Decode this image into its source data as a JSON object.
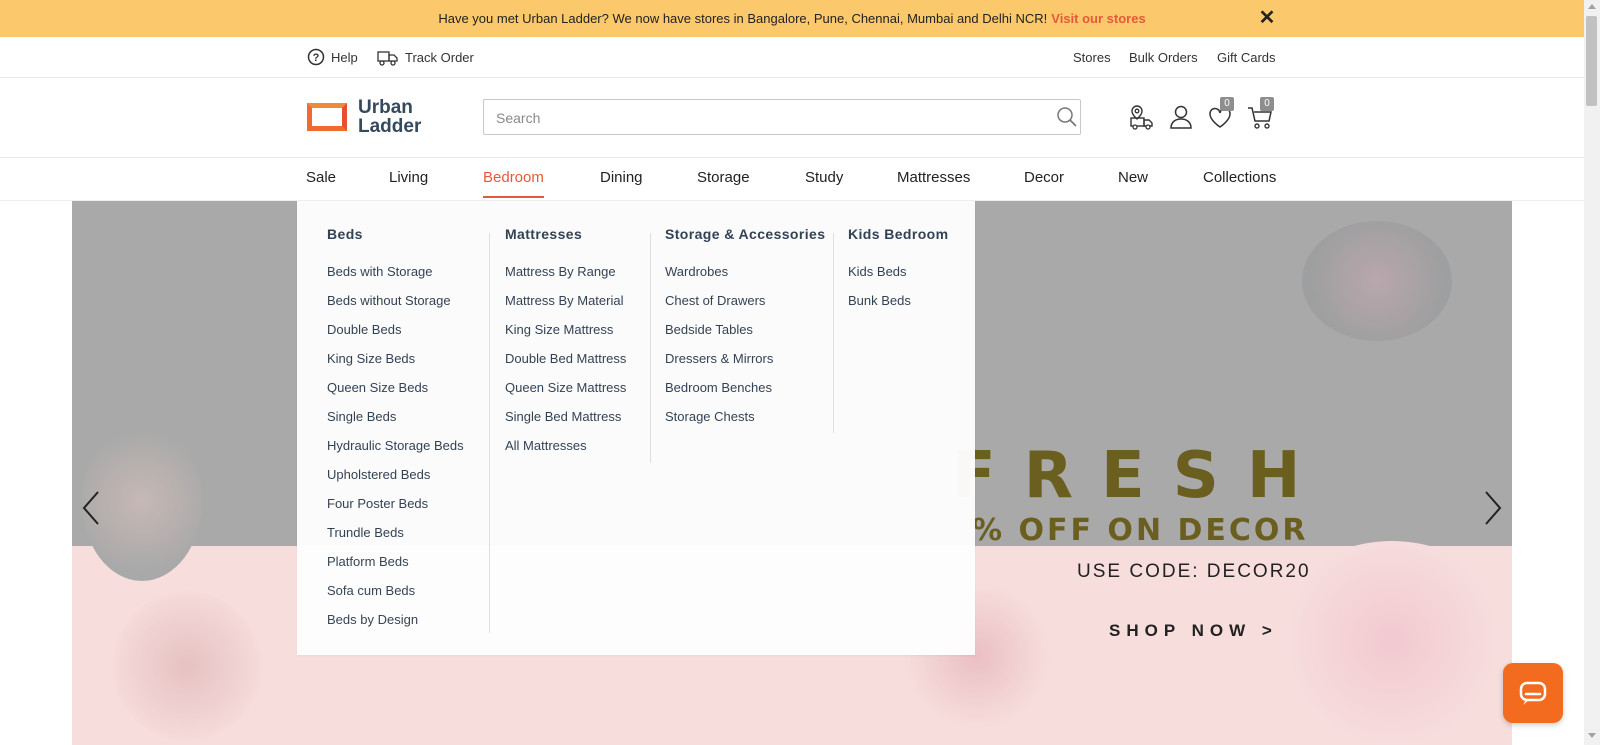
{
  "announcement": {
    "text": "Have you met Urban Ladder? We now have stores in Bangalore, Pune, Chennai, Mumbai and Delhi NCR!",
    "link": "Visit our stores"
  },
  "utility_bar": {
    "help": "Help",
    "track_order": "Track Order",
    "right_links": [
      "Stores",
      "Bulk Orders",
      "Gift Cards"
    ]
  },
  "header": {
    "logo_line1": "Urban",
    "logo_line2": "Ladder",
    "search_placeholder": "Search",
    "wishlist_count": "0",
    "cart_count": "0"
  },
  "nav": {
    "items": [
      "Sale",
      "Living",
      "Bedroom",
      "Dining",
      "Storage",
      "Study",
      "Mattresses",
      "Decor",
      "New",
      "Collections"
    ],
    "active": "Bedroom"
  },
  "mega_menu": {
    "columns": [
      {
        "title": "Beds",
        "links": [
          "Beds with Storage",
          "Beds without Storage",
          "Double Beds",
          "King Size Beds",
          "Queen Size Beds",
          "Single Beds",
          "Hydraulic Storage Beds",
          "Upholstered Beds",
          "Four Poster Beds",
          "Trundle Beds",
          "Platform Beds",
          "Sofa cum Beds",
          "Beds by Design"
        ]
      },
      {
        "title": "Mattresses",
        "links": [
          "Mattress By Range",
          "Mattress By Material",
          "King Size Mattress",
          "Double Bed Mattress",
          "Queen Size Mattress",
          "Single Bed Mattress",
          "All Mattresses"
        ]
      },
      {
        "title": "Storage & Accessories",
        "links": [
          "Wardrobes",
          "Chest of Drawers",
          "Bedside Tables",
          "Dressers & Mirrors",
          "Bedroom Benches",
          "Storage Chests"
        ]
      },
      {
        "title": "Kids Bedroom",
        "links": [
          "Kids Beds",
          "Bunk Beds"
        ]
      }
    ]
  },
  "hero": {
    "headline": "FRESH",
    "offer": "% OFF ON DECOR",
    "code": "USE CODE: DECOR20",
    "cta": "SHOP NOW >"
  },
  "colors": {
    "announcement_bg": "#fbc96b",
    "accent": "#e5593b",
    "menu_text": "#2e3e52",
    "chat_button": "#f26b1f"
  }
}
